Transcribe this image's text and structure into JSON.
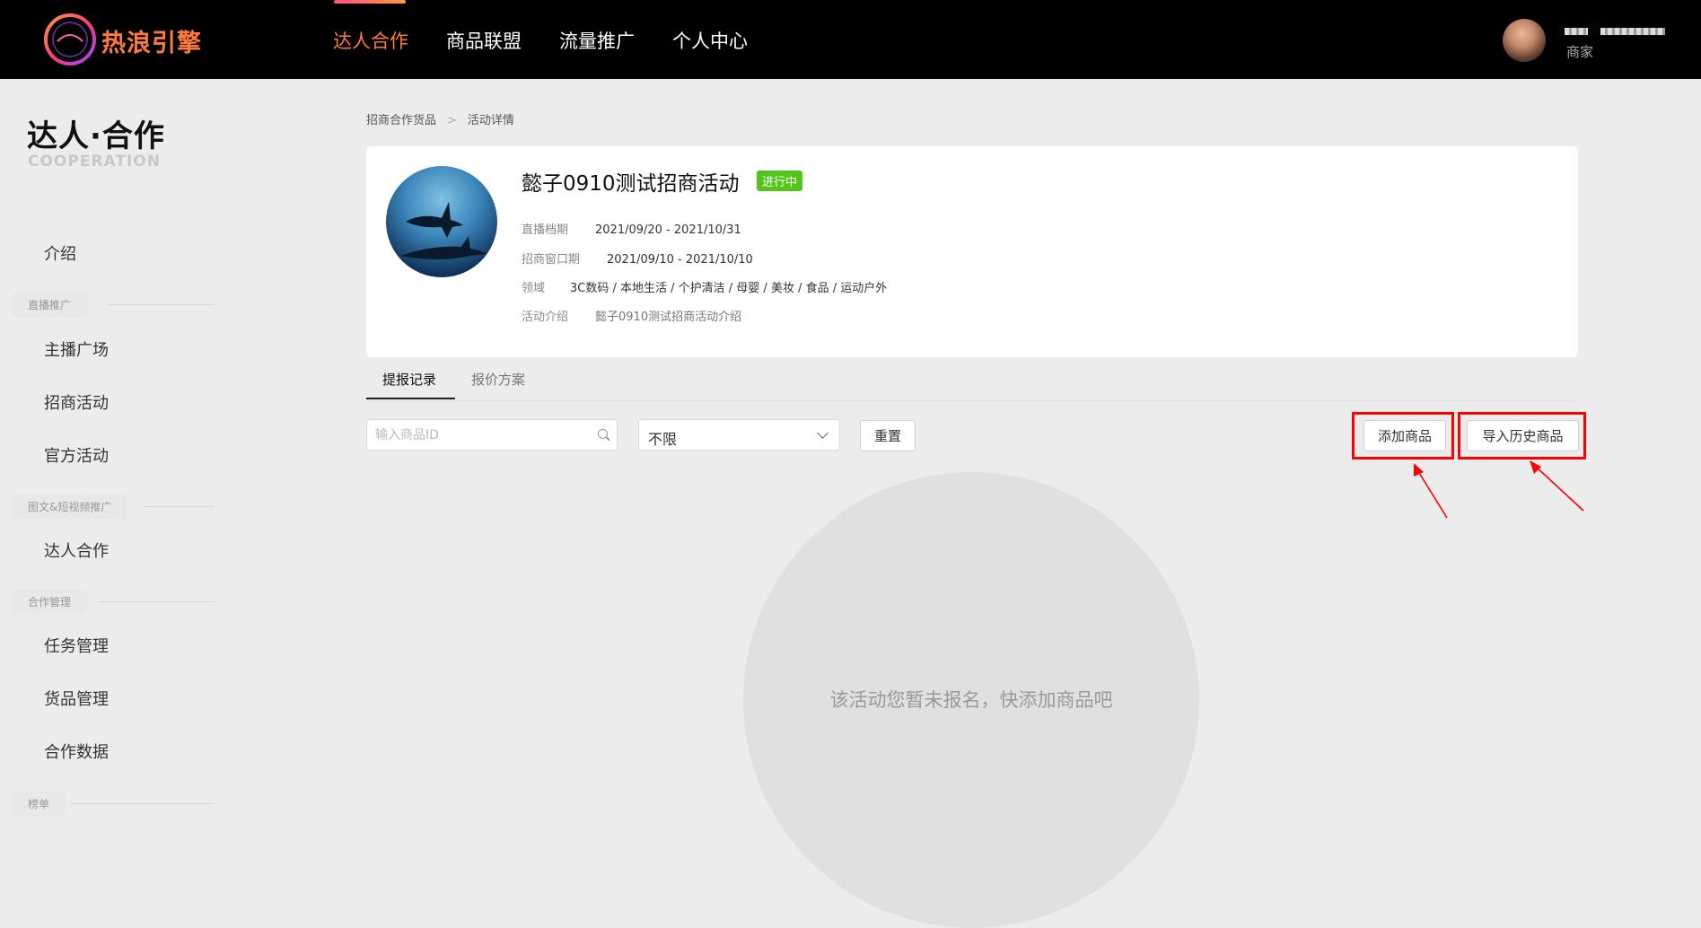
{
  "header": {
    "logo_text": "热浪引擎",
    "nav": [
      {
        "label": "达人合作",
        "active": true
      },
      {
        "label": "商品联盟",
        "active": false
      },
      {
        "label": "流量推广",
        "active": false
      },
      {
        "label": "个人中心",
        "active": false
      }
    ],
    "user_role": "商家"
  },
  "sidebar": {
    "title": "达人·合作",
    "subtitle": "COOPERATION",
    "intro": "介绍",
    "groups": [
      {
        "label": "直播推广",
        "items": [
          "主播广场",
          "招商活动",
          "官方活动"
        ]
      },
      {
        "label": "图文&短视频推广",
        "items": [
          "达人合作"
        ]
      },
      {
        "label": "合作管理",
        "items": [
          "任务管理",
          "货品管理",
          "合作数据"
        ]
      },
      {
        "label": "榜单",
        "items": []
      }
    ]
  },
  "breadcrumb": [
    "招商合作货品",
    "活动详情"
  ],
  "activity": {
    "title": "懿子0910测试招商活动",
    "status": "进行中",
    "info": [
      {
        "key": "直播档期",
        "value": "2021/09/20 - 2021/10/31"
      },
      {
        "key": "招商窗口期",
        "value": "2021/09/10 - 2021/10/10"
      },
      {
        "key": "领域",
        "value": "3C数码 / 本地生活 / 个护清洁 / 母婴 / 美妆 / 食品 / 运动户外"
      },
      {
        "key": "活动介绍",
        "value": "懿子0910测试招商活动介绍"
      }
    ]
  },
  "tabs": [
    {
      "label": "提报记录",
      "active": true
    },
    {
      "label": "报价方案",
      "active": false
    }
  ],
  "filters": {
    "search_placeholder": "输入商品ID",
    "select_value": "不限",
    "reset_label": "重置"
  },
  "actions": {
    "add_label": "添加商品",
    "import_label": "导入历史商品"
  },
  "empty_text": "该活动您暂未报名，快添加商品吧",
  "colors": {
    "accent": "#ff7a3d",
    "status_green": "#52c41a",
    "highlight_red": "#ff0000"
  }
}
